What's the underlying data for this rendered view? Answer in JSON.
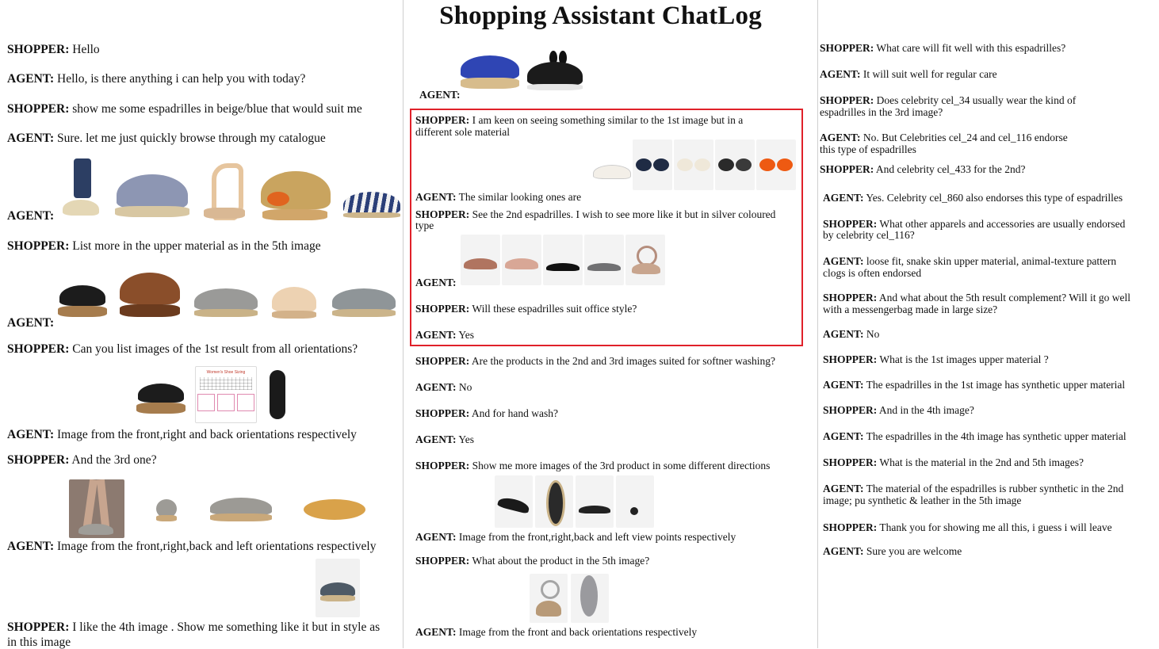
{
  "title": "Shopping Assistant ChatLog",
  "speakers": {
    "shopper": "SHOPPER:",
    "agent": "AGENT:"
  },
  "col1": [
    {
      "speaker": "SHOPPER:",
      "text": " Hello"
    },
    {
      "speaker": "AGENT:",
      "text": " Hello, is there anything i can help you with today?"
    },
    {
      "speaker": "SHOPPER:",
      "text": " show me some espadrilles in beige/blue that would suit me"
    },
    {
      "speaker": "AGENT:",
      "text": " Sure. let me just quickly browse through my catalogue"
    },
    {
      "speaker": "AGENT:",
      "text": ""
    },
    {
      "speaker": "SHOPPER:",
      "text": " List more in the upper material as in the 5th image"
    },
    {
      "speaker": "AGENT:",
      "text": ""
    },
    {
      "speaker": "SHOPPER:",
      "text": " Can you list images of the 1st result from all orientations?"
    },
    {
      "speaker": "AGENT:",
      "text": " Image from the front,right and back orientations respectively"
    },
    {
      "speaker": "SHOPPER:",
      "text": " And the 3rd one?"
    },
    {
      "speaker": "AGENT:",
      "text": " Image from the front,right,back and left orientations respectively"
    },
    {
      "speaker": "SHOPPER:",
      "text": " I like the 4th image . Show me something like it but in style as"
    },
    {
      "speaker": "",
      "text": "in this image"
    }
  ],
  "size_chart_label": "Women's Shoe Sizing",
  "col2": [
    {
      "speaker": "AGENT:",
      "text": ""
    },
    {
      "speaker": "SHOPPER:",
      "text": " I am keen on seeing something similar to the 1st image but in a"
    },
    {
      "speaker": "",
      "text": "different sole material"
    },
    {
      "speaker": "AGENT:",
      "text": " The similar looking ones are"
    },
    {
      "speaker": "SHOPPER:",
      "text": " See the 2nd espadrilles. I wish to see more like it but in silver coloured"
    },
    {
      "speaker": "",
      "text": "type"
    },
    {
      "speaker": "AGENT:",
      "text": ""
    },
    {
      "speaker": "SHOPPER:",
      "text": " Will these espadrilles suit office style?"
    },
    {
      "speaker": "AGENT:",
      "text": " Yes"
    },
    {
      "speaker": "SHOPPER:",
      "text": " Are the products in the 2nd and 3rd images suited for softner washing?"
    },
    {
      "speaker": "AGENT:",
      "text": " No"
    },
    {
      "speaker": "SHOPPER:",
      "text": " And for hand wash?"
    },
    {
      "speaker": "AGENT:",
      "text": " Yes"
    },
    {
      "speaker": "SHOPPER:",
      "text": " Show me more images of the 3rd product in some different directions"
    },
    {
      "speaker": "AGENT:",
      "text": " Image from the front,right,back and left view points respectively"
    },
    {
      "speaker": "SHOPPER:",
      "text": " What about the product in the 5th image?"
    },
    {
      "speaker": "AGENT:",
      "text": " Image from the front and back orientations respectively"
    }
  ],
  "col3": [
    {
      "speaker": "SHOPPER:",
      "text": " What care will fit well with this espadrilles?"
    },
    {
      "speaker": "AGENT:",
      "text": " It will suit well for regular care"
    },
    {
      "speaker": "SHOPPER:",
      "text": " Does celebrity cel_34 usually wear the kind of"
    },
    {
      "speaker": "",
      "text": "espadrilles in the 3rd image?"
    },
    {
      "speaker": "AGENT:",
      "text": " No. But Celebrities cel_24 and cel_116 endorse"
    },
    {
      "speaker": "",
      "text": "this type of espadrilles"
    },
    {
      "speaker": "SHOPPER:",
      "text": " And celebrity cel_433 for the 2nd?"
    },
    {
      "speaker": "AGENT:",
      "text": " Yes. Celebrity cel_860 also endorses this type of espadrilles"
    },
    {
      "speaker": "SHOPPER:",
      "text": " What other apparels and accessories are usually endorsed"
    },
    {
      "speaker": "",
      "text": "by celebrity cel_116?"
    },
    {
      "speaker": "AGENT:",
      "text": " loose fit, snake skin upper material, animal-texture pattern"
    },
    {
      "speaker": "",
      "text": "clogs is often endorsed"
    },
    {
      "speaker": "SHOPPER:",
      "text": " And what about the 5th result complement? Will it go well"
    },
    {
      "speaker": "",
      "text": "with a messengerbag made in large size?"
    },
    {
      "speaker": "AGENT:",
      "text": " No"
    },
    {
      "speaker": "SHOPPER:",
      "text": " What is the 1st images upper material ?"
    },
    {
      "speaker": "AGENT:",
      "text": " The espadrilles in the 1st image has synthetic upper material"
    },
    {
      "speaker": "SHOPPER:",
      "text": " And in the 4th image?"
    },
    {
      "speaker": "AGENT:",
      "text": " The espadrilles in the 4th image has synthetic upper material"
    },
    {
      "speaker": "SHOPPER:",
      "text": " What is the material in the 2nd and 5th images?"
    },
    {
      "speaker": "AGENT:",
      "text": " The material of the espadrilles is rubber synthetic in the 2nd"
    },
    {
      "speaker": "",
      "text": "image; pu synthetic & leather in the 5th image"
    },
    {
      "speaker": "SHOPPER:",
      "text": " Thank you for showing me all this, i guess i will leave"
    },
    {
      "speaker": "AGENT:",
      "text": " Sure you are welcome"
    }
  ]
}
